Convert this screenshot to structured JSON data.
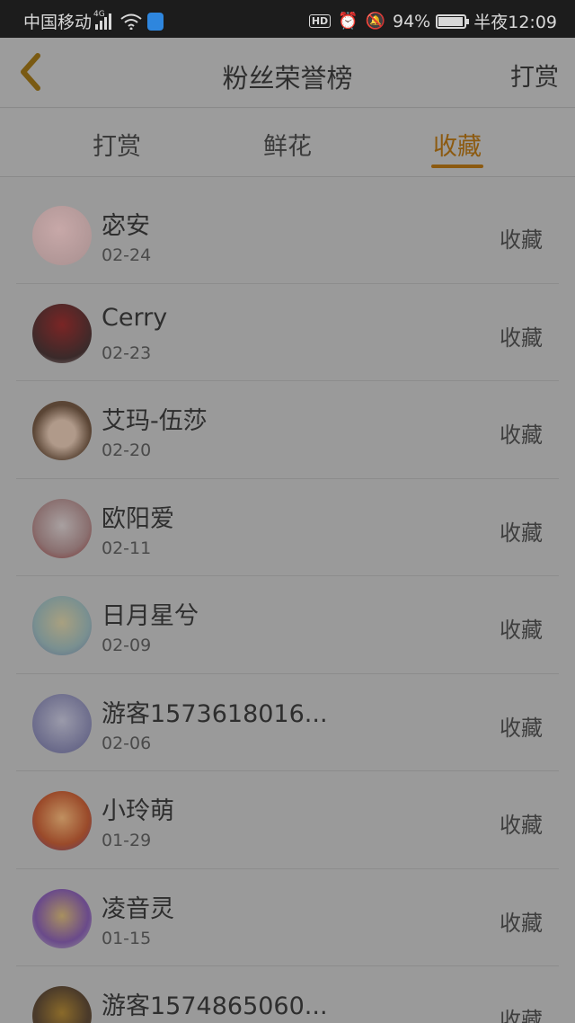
{
  "status_bar": {
    "carrier": "中国移动",
    "network": "4G",
    "hd": "HD",
    "battery": "94%",
    "time": "半夜12:09"
  },
  "nav": {
    "title": "粉丝荣誉榜",
    "action": "打赏"
  },
  "tabs": [
    {
      "label": "打赏"
    },
    {
      "label": "鲜花"
    },
    {
      "label": "收藏"
    }
  ],
  "active_tab": 2,
  "accent_color": "#8c5a10",
  "items": [
    {
      "name": "宓安",
      "date": "02-24",
      "action": "收藏"
    },
    {
      "name": "Cerry",
      "date": "02-23",
      "action": "收藏"
    },
    {
      "name": "艾玛-伍莎",
      "date": "02-20",
      "action": "收藏"
    },
    {
      "name": "欧阳爱",
      "date": "02-11",
      "action": "收藏"
    },
    {
      "name": "日月星兮",
      "date": "02-09",
      "action": "收藏"
    },
    {
      "name": "游客1573618016...",
      "date": "02-06",
      "action": "收藏"
    },
    {
      "name": "小玲萌",
      "date": "01-29",
      "action": "收藏"
    },
    {
      "name": "凌音灵",
      "date": "01-15",
      "action": "收藏"
    },
    {
      "name": "游客1574865060...",
      "date": "",
      "action": "收藏"
    }
  ]
}
